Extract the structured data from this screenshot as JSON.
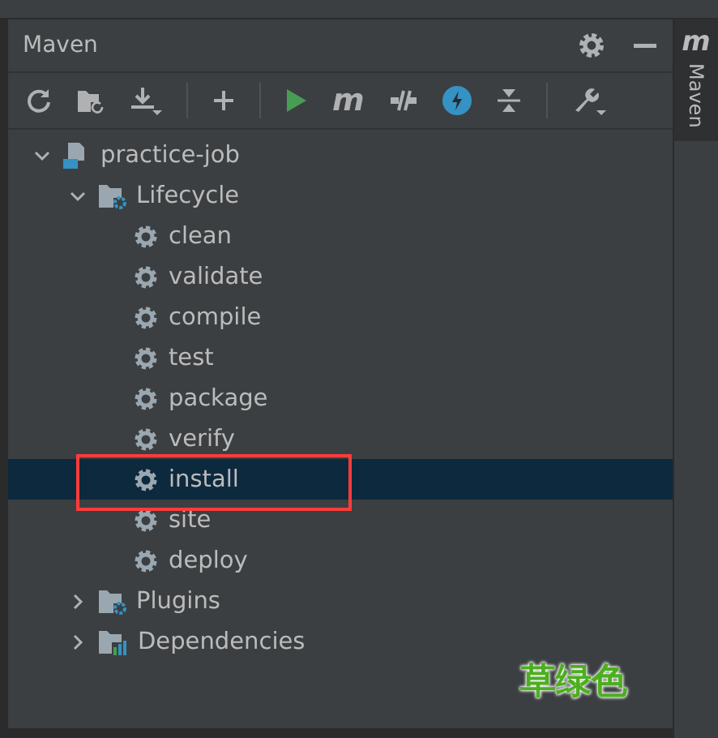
{
  "panel": {
    "title": "Maven"
  },
  "toolbar": [
    {
      "kind": "reload"
    },
    {
      "kind": "folder-reload"
    },
    {
      "kind": "download"
    },
    {
      "kind": "separator"
    },
    {
      "kind": "add"
    },
    {
      "kind": "separator"
    },
    {
      "kind": "run"
    },
    {
      "kind": "maven",
      "glyph": "m"
    },
    {
      "kind": "offline"
    },
    {
      "kind": "skip"
    },
    {
      "kind": "collapse"
    },
    {
      "kind": "separator"
    },
    {
      "kind": "wrench"
    }
  ],
  "tree": [
    {
      "label": "practice-job",
      "kind": "project",
      "expanded": true,
      "selected": false,
      "children": [
        {
          "label": "Lifecycle",
          "kind": "lifecycle",
          "expanded": true,
          "selected": false,
          "children": [
            {
              "label": "clean",
              "kind": "goal",
              "selected": false
            },
            {
              "label": "validate",
              "kind": "goal",
              "selected": false
            },
            {
              "label": "compile",
              "kind": "goal",
              "selected": false
            },
            {
              "label": "test",
              "kind": "goal",
              "selected": false
            },
            {
              "label": "package",
              "kind": "goal",
              "selected": false
            },
            {
              "label": "verify",
              "kind": "goal",
              "selected": false
            },
            {
              "label": "install",
              "kind": "goal",
              "selected": true
            },
            {
              "label": "site",
              "kind": "goal",
              "selected": false
            },
            {
              "label": "deploy",
              "kind": "goal",
              "selected": false
            }
          ]
        },
        {
          "label": "Plugins",
          "kind": "plugins",
          "expanded": false,
          "selected": false
        },
        {
          "label": "Dependencies",
          "kind": "dependencies",
          "expanded": false,
          "selected": false
        }
      ]
    }
  ],
  "side_stripe": {
    "glyph": "m",
    "label": "Maven"
  },
  "annotation": {
    "text": "草绿色"
  }
}
